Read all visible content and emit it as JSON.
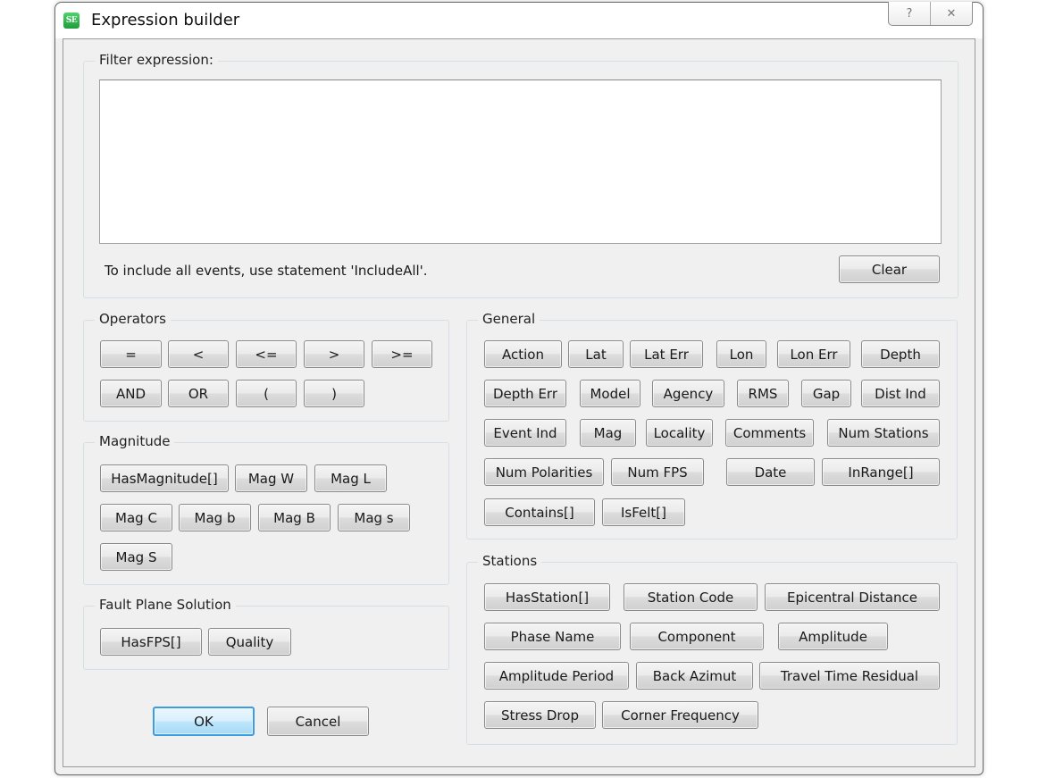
{
  "window": {
    "title": "Expression builder",
    "app_icon_text": "SE",
    "help_icon": "?",
    "close_icon": "✕"
  },
  "filter": {
    "label": "Filter expression:",
    "value": "",
    "hint": "To include all events, use statement 'IncludeAll'.",
    "clear_label": "Clear"
  },
  "operators": {
    "label": "Operators",
    "buttons": [
      "=",
      "<",
      "<=",
      ">",
      ">=",
      "AND",
      "OR",
      "(",
      ")"
    ]
  },
  "magnitude": {
    "label": "Magnitude",
    "buttons": [
      "HasMagnitude[]",
      "Mag W",
      "Mag L",
      "Mag C",
      "Mag b",
      "Mag B",
      "Mag s",
      "Mag S"
    ]
  },
  "fps": {
    "label": "Fault Plane Solution",
    "buttons": [
      "HasFPS[]",
      "Quality"
    ]
  },
  "general": {
    "label": "General",
    "buttons": [
      "Action",
      "Lat",
      "Lat Err",
      "Lon",
      "Lon Err",
      "Depth",
      "Depth Err",
      "Model",
      "Agency",
      "RMS",
      "Gap",
      "Dist Ind",
      "Event Ind",
      "Mag",
      "Locality",
      "Comments",
      "Num Stations",
      "Num Polarities",
      "Num FPS",
      "Date",
      "InRange[]",
      "Contains[]",
      "IsFelt[]"
    ]
  },
  "stations": {
    "label": "Stations",
    "buttons": [
      "HasStation[]",
      "Station Code",
      "Epicentral Distance",
      "Phase Name",
      "Component",
      "Amplitude",
      "Amplitude Period",
      "Back Azimut",
      "Travel Time Residual",
      "Stress Drop",
      "Corner Frequency"
    ]
  },
  "footer": {
    "ok_label": "OK",
    "cancel_label": "Cancel"
  }
}
